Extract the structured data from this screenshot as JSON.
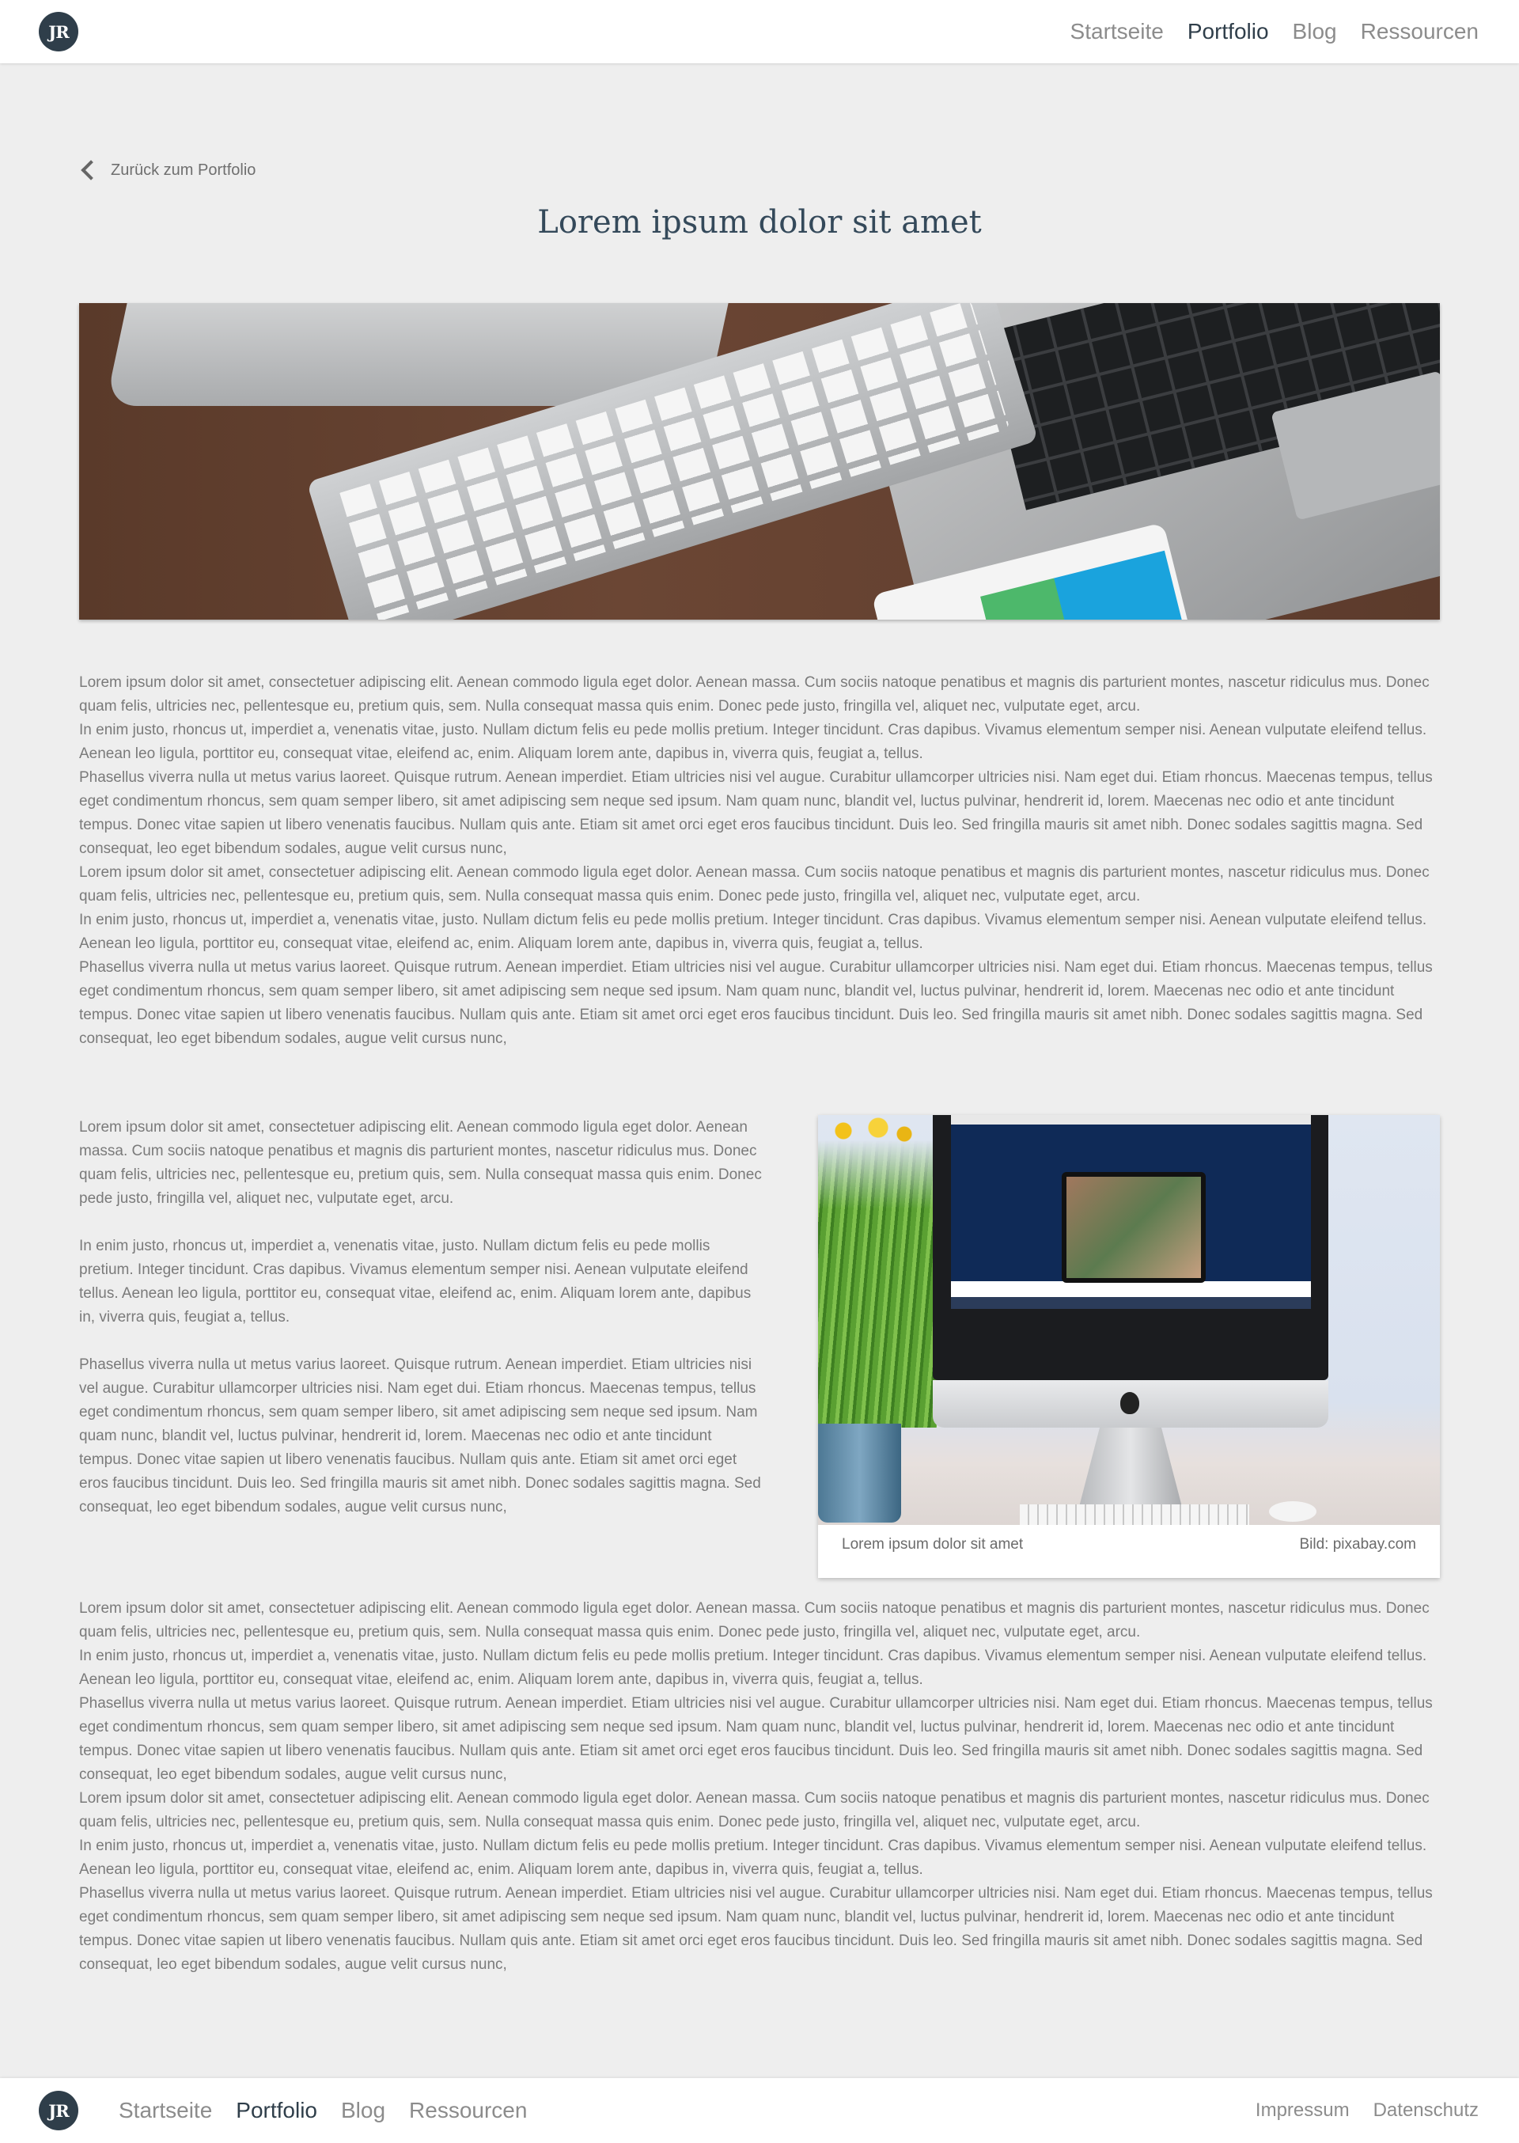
{
  "brand": {
    "initials": "JR"
  },
  "nav": {
    "items": [
      {
        "label": "Startseite",
        "active": false
      },
      {
        "label": "Portfolio",
        "active": true
      },
      {
        "label": "Blog",
        "active": false
      },
      {
        "label": "Ressourcen",
        "active": false
      }
    ]
  },
  "back_link": {
    "label": "Zurück zum Portfolio"
  },
  "page": {
    "title": "Lorem ipsum dolor sit amet"
  },
  "hero": {
    "alt": "desk with keyboard, laptop and tablet"
  },
  "block1": {
    "paragraphs": [
      "Lorem ipsum dolor sit amet, consectetuer adipiscing elit. Aenean commodo ligula eget dolor. Aenean massa. Cum sociis natoque penatibus et magnis dis parturient montes, nascetur ridiculus mus. Donec quam felis, ultricies nec, pellentesque eu, pretium quis, sem. Nulla consequat massa quis enim. Donec pede justo, fringilla vel, aliquet nec, vulputate eget, arcu.",
      "In enim justo, rhoncus ut, imperdiet a, venenatis vitae, justo. Nullam dictum felis eu pede mollis pretium. Integer tincidunt. Cras dapibus. Vivamus elementum semper nisi. Aenean vulputate eleifend tellus. Aenean leo ligula, porttitor eu, consequat vitae, eleifend ac, enim. Aliquam lorem ante, dapibus in, viverra quis, feugiat a, tellus.",
      "Phasellus viverra nulla ut metus varius laoreet. Quisque rutrum. Aenean imperdiet. Etiam ultricies nisi vel augue. Curabitur ullamcorper ultricies nisi. Nam eget dui. Etiam rhoncus. Maecenas tempus, tellus eget condimentum rhoncus, sem quam semper libero, sit amet adipiscing sem neque sed ipsum. Nam quam nunc, blandit vel, luctus pulvinar, hendrerit id, lorem. Maecenas nec odio et ante tincidunt tempus. Donec vitae sapien ut libero venenatis faucibus. Nullam quis ante. Etiam sit amet orci eget eros faucibus tincidunt. Duis leo. Sed fringilla mauris sit amet nibh. Donec sodales sagittis magna. Sed consequat, leo eget bibendum sodales, augue velit cursus nunc,",
      "Lorem ipsum dolor sit amet, consectetuer adipiscing elit. Aenean commodo ligula eget dolor. Aenean massa. Cum sociis natoque penatibus et magnis dis parturient montes, nascetur ridiculus mus. Donec quam felis, ultricies nec, pellentesque eu, pretium quis, sem. Nulla consequat massa quis enim. Donec pede justo, fringilla vel, aliquet nec, vulputate eget, arcu.",
      "In enim justo, rhoncus ut, imperdiet a, venenatis vitae, justo. Nullam dictum felis eu pede mollis pretium. Integer tincidunt. Cras dapibus. Vivamus elementum semper nisi. Aenean vulputate eleifend tellus. Aenean leo ligula, porttitor eu, consequat vitae, eleifend ac, enim. Aliquam lorem ante, dapibus in, viverra quis, feugiat a, tellus.",
      "Phasellus viverra nulla ut metus varius laoreet. Quisque rutrum. Aenean imperdiet. Etiam ultricies nisi vel augue. Curabitur ullamcorper ultricies nisi. Nam eget dui. Etiam rhoncus. Maecenas tempus, tellus eget condimentum rhoncus, sem quam semper libero, sit amet adipiscing sem neque sed ipsum. Nam quam nunc, blandit vel, luctus pulvinar, hendrerit id, lorem. Maecenas nec odio et ante tincidunt tempus. Donec vitae sapien ut libero venenatis faucibus. Nullam quis ante. Etiam sit amet orci eget eros faucibus tincidunt. Duis leo. Sed fringilla mauris sit amet nibh. Donec sodales sagittis magna. Sed consequat, leo eget bibendum sodales, augue velit cursus nunc,"
    ]
  },
  "two_col": {
    "paragraphs": [
      "Lorem ipsum dolor sit amet, consectetuer adipiscing elit. Aenean commodo ligula eget dolor. Aenean massa. Cum sociis natoque penatibus et magnis dis parturient montes, nascetur ridiculus mus. Donec quam felis, ultricies nec, pellentesque eu, pretium quis, sem. Nulla consequat massa quis enim. Donec pede justo, fringilla vel, aliquet nec, vulputate eget, arcu.",
      "In enim justo, rhoncus ut, imperdiet a, venenatis vitae, justo. Nullam dictum felis eu pede mollis pretium. Integer tincidunt. Cras dapibus. Vivamus elementum semper nisi. Aenean vulputate eleifend tellus. Aenean leo ligula, porttitor eu, consequat vitae, eleifend ac, enim. Aliquam lorem ante, dapibus in, viverra quis, feugiat a, tellus.",
      "Phasellus viverra nulla ut metus varius laoreet. Quisque rutrum. Aenean imperdiet. Etiam ultricies nisi vel augue. Curabitur ullamcorper ultricies nisi. Nam eget dui. Etiam rhoncus. Maecenas tempus, tellus eget condimentum rhoncus, sem quam semper libero, sit amet adipiscing sem neque sed ipsum. Nam quam nunc, blandit vel, luctus pulvinar, hendrerit id, lorem. Maecenas nec odio et ante tincidunt tempus. Donec vitae sapien ut libero venenatis faucibus. Nullam quis ante. Etiam sit amet orci eget eros faucibus tincidunt. Duis leo. Sed fringilla mauris sit amet nibh. Donec sodales sagittis magna. Sed consequat, leo eget bibendum sodales, augue velit cursus nunc,"
    ],
    "figure": {
      "caption": "Lorem ipsum dolor sit amet",
      "credit": "Bild: pixabay.com"
    }
  },
  "block3": {
    "paragraphs": [
      "Lorem ipsum dolor sit amet, consectetuer adipiscing elit. Aenean commodo ligula eget dolor. Aenean massa. Cum sociis natoque penatibus et magnis dis parturient montes, nascetur ridiculus mus. Donec quam felis, ultricies nec, pellentesque eu, pretium quis, sem. Nulla consequat massa quis enim. Donec pede justo, fringilla vel, aliquet nec, vulputate eget, arcu.",
      "In enim justo, rhoncus ut, imperdiet a, venenatis vitae, justo. Nullam dictum felis eu pede mollis pretium. Integer tincidunt. Cras dapibus. Vivamus elementum semper nisi. Aenean vulputate eleifend tellus. Aenean leo ligula, porttitor eu, consequat vitae, eleifend ac, enim. Aliquam lorem ante, dapibus in, viverra quis, feugiat a, tellus.",
      "Phasellus viverra nulla ut metus varius laoreet. Quisque rutrum. Aenean imperdiet. Etiam ultricies nisi vel augue. Curabitur ullamcorper ultricies nisi. Nam eget dui. Etiam rhoncus. Maecenas tempus, tellus eget condimentum rhoncus, sem quam semper libero, sit amet adipiscing sem neque sed ipsum. Nam quam nunc, blandit vel, luctus pulvinar, hendrerit id, lorem. Maecenas nec odio et ante tincidunt tempus. Donec vitae sapien ut libero venenatis faucibus. Nullam quis ante. Etiam sit amet orci eget eros faucibus tincidunt. Duis leo. Sed fringilla mauris sit amet nibh. Donec sodales sagittis magna. Sed consequat, leo eget bibendum sodales, augue velit cursus nunc,",
      "Lorem ipsum dolor sit amet, consectetuer adipiscing elit. Aenean commodo ligula eget dolor. Aenean massa. Cum sociis natoque penatibus et magnis dis parturient montes, nascetur ridiculus mus. Donec quam felis, ultricies nec, pellentesque eu, pretium quis, sem. Nulla consequat massa quis enim. Donec pede justo, fringilla vel, aliquet nec, vulputate eget, arcu.",
      "In enim justo, rhoncus ut, imperdiet a, venenatis vitae, justo. Nullam dictum felis eu pede mollis pretium. Integer tincidunt. Cras dapibus. Vivamus elementum semper nisi. Aenean vulputate eleifend tellus. Aenean leo ligula, porttitor eu, consequat vitae, eleifend ac, enim. Aliquam lorem ante, dapibus in, viverra quis, feugiat a, tellus.",
      "Phasellus viverra nulla ut metus varius laoreet. Quisque rutrum. Aenean imperdiet. Etiam ultricies nisi vel augue. Curabitur ullamcorper ultricies nisi. Nam eget dui. Etiam rhoncus. Maecenas tempus, tellus eget condimentum rhoncus, sem quam semper libero, sit amet adipiscing sem neque sed ipsum. Nam quam nunc, blandit vel, luctus pulvinar, hendrerit id, lorem. Maecenas nec odio et ante tincidunt tempus. Donec vitae sapien ut libero venenatis faucibus. Nullam quis ante. Etiam sit amet orci eget eros faucibus tincidunt. Duis leo. Sed fringilla mauris sit amet nibh. Donec sodales sagittis magna. Sed consequat, leo eget bibendum sodales, augue velit cursus nunc,"
    ]
  },
  "footer": {
    "nav": [
      {
        "label": "Startseite",
        "active": false
      },
      {
        "label": "Portfolio",
        "active": true
      },
      {
        "label": "Blog",
        "active": false
      },
      {
        "label": "Ressourcen",
        "active": false
      }
    ],
    "legal": [
      {
        "label": "Impressum"
      },
      {
        "label": "Datenschutz"
      }
    ]
  },
  "colors": {
    "page_bg": "#eeeeee",
    "brand": "#2f3e4a",
    "title": "#34495a",
    "nav_inactive": "#8c8c8c",
    "body_text": "#7a7a7a"
  }
}
